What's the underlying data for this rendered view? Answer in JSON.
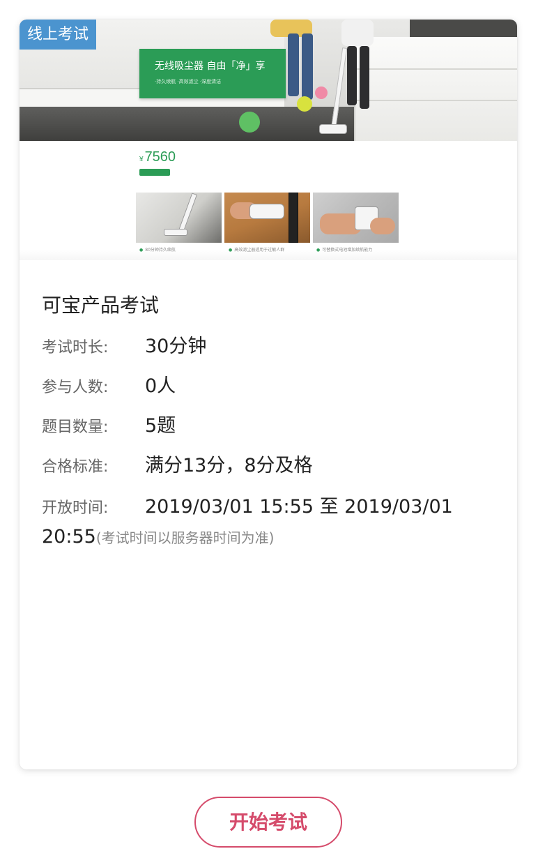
{
  "card": {
    "tag": "线上考试",
    "banner": {
      "headline": "无线吸尘器 自由「净」享",
      "subline": "·持久续航 ·高效滤尘 ·深度清洁",
      "price_symbol": "¥",
      "price": "7560",
      "captions": [
        "80分钟持久续航",
        "高效滤尘器适用于过敏人群",
        "可替换式电池增加续航能力"
      ]
    },
    "title": "可宝产品考试",
    "rows": [
      {
        "label": "考试时长:",
        "value": "30分钟"
      },
      {
        "label": "参与人数:",
        "value": "0人"
      },
      {
        "label": "题目数量:",
        "value": "5题"
      },
      {
        "label": "合格标准:",
        "value": "满分13分，8分及格"
      }
    ],
    "open_time": {
      "label": "开放时间:",
      "value_line1": "2019/03/01 15:55 至 2019/03/01",
      "value_line2": "20:55",
      "note": "(考试时间以服务器时间为准)"
    }
  },
  "start_button": "开始考试",
  "colors": {
    "tag_bg": "#4b94cf",
    "brand_green": "#2b9c56",
    "button_accent": "#d54b6b"
  }
}
